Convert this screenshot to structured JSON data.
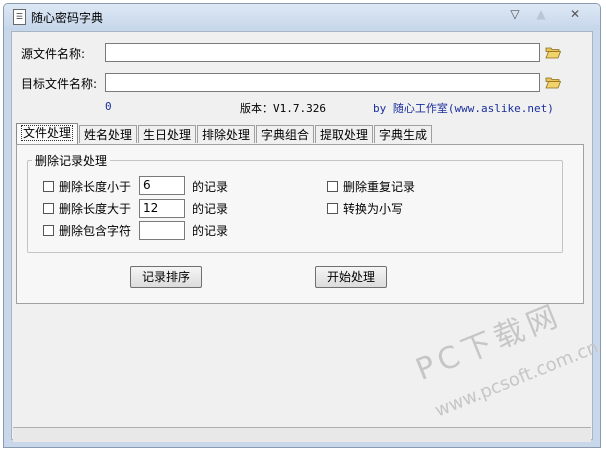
{
  "window": {
    "title": "随心密码字典",
    "minimize_glyph": "▽",
    "maximize_glyph": "▲",
    "close_glyph": "✕"
  },
  "files": {
    "source_label": "源文件名称:",
    "source_value": "",
    "target_label": "目标文件名称:",
    "target_value": ""
  },
  "info": {
    "count": "0",
    "version": "版本：V1.7.326",
    "author": "by 随心工作室(www.aslike.net)"
  },
  "tabs": [
    "文件处理",
    "姓名处理",
    "生日处理",
    "排除处理",
    "字典组合",
    "提取处理",
    "字典生成"
  ],
  "group": {
    "title": "删除记录处理",
    "opt_min_len": "删除长度小于",
    "min_len_value": "6",
    "opt_max_len": "删除长度大于",
    "max_len_value": "12",
    "opt_contains": "删除包含字符",
    "contains_value": "",
    "suffix": "的记录",
    "opt_dedupe": "删除重复记录",
    "opt_lowercase": "转换为小写"
  },
  "buttons": {
    "sort": "记录排序",
    "start": "开始处理"
  },
  "watermark": {
    "main": "PC下载网",
    "url": "www.pcsoft.com.cn"
  },
  "colors": {
    "blue_text": "#1a2e9c",
    "window_frame": "#c8d8ea"
  }
}
